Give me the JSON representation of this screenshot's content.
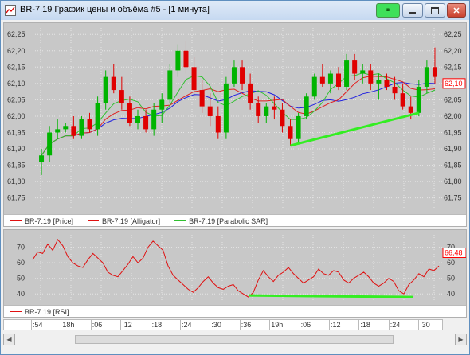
{
  "window": {
    "title": "BR-7.19 График цены и объёма #5 - [1 минута]",
    "buttons": [
      {
        "name": "link-button",
        "icon": "link-icon"
      },
      {
        "name": "minimize-button",
        "icon": "minimize-icon"
      },
      {
        "name": "maximize-button",
        "icon": "maximize-icon"
      },
      {
        "name": "close-button",
        "icon": "close-icon"
      }
    ]
  },
  "colors": {
    "price_up": "#00b400",
    "price_down": "#e00000",
    "alligator_jaw": "#2020e0",
    "alligator_teeth": "#e02020",
    "alligator_lips": "#30c030",
    "trendline": "#33ee22",
    "rsi_line": "#e01010",
    "current_price_box": "#ff0000",
    "pane_bg": "#c8c8c8",
    "grid": "#e6e6e6"
  },
  "price_pane": {
    "axis_labels": [
      "62,25",
      "62,20",
      "62,15",
      "62,10",
      "62,05",
      "62,00",
      "61,95",
      "61,90",
      "61,85",
      "61,80",
      "61,75"
    ],
    "current_price": "62,10",
    "legend": [
      {
        "label": "BR-7.19 [Price]",
        "color": "#e01010"
      },
      {
        "label": "BR-7.19 [Alligator]",
        "color": "#e01010"
      },
      {
        "label": "BR-7.19 [Parabolic SAR]",
        "color": "#30c030"
      }
    ]
  },
  "rsi_pane": {
    "axis_labels_left": [
      "70",
      "60",
      "50",
      "40"
    ],
    "axis_labels_right": [
      "70",
      "60",
      "50",
      "40"
    ],
    "current_value": "66,48",
    "legend": [
      {
        "label": "BR-7.19 [RSI]",
        "color": "#e01010"
      }
    ]
  },
  "time_axis": [
    ":54",
    "18h",
    ":06",
    ":12",
    ":18",
    ":24",
    ":30",
    ":36",
    "19h",
    ":06",
    ":12",
    ":18",
    ":24",
    ":30"
  ],
  "chart_data": {
    "type": "candlestick",
    "ylim": [
      61.72,
      62.27
    ],
    "candles": [
      {
        "o": 61.86,
        "h": 61.9,
        "l": 61.82,
        "c": 61.88
      },
      {
        "o": 61.88,
        "h": 61.97,
        "l": 61.86,
        "c": 61.95
      },
      {
        "o": 61.95,
        "h": 61.99,
        "l": 61.93,
        "c": 61.96
      },
      {
        "o": 61.96,
        "h": 61.98,
        "l": 61.95,
        "c": 61.97
      },
      {
        "o": 61.97,
        "h": 62.0,
        "l": 61.93,
        "c": 61.94
      },
      {
        "o": 61.94,
        "h": 62.0,
        "l": 61.93,
        "c": 61.99
      },
      {
        "o": 61.99,
        "h": 62.01,
        "l": 61.95,
        "c": 61.96
      },
      {
        "o": 61.96,
        "h": 62.06,
        "l": 61.94,
        "c": 62.04
      },
      {
        "o": 62.04,
        "h": 62.14,
        "l": 62.02,
        "c": 62.12
      },
      {
        "o": 62.12,
        "h": 62.16,
        "l": 62.07,
        "c": 62.08
      },
      {
        "o": 62.08,
        "h": 62.12,
        "l": 62.02,
        "c": 62.04
      },
      {
        "o": 62.04,
        "h": 62.06,
        "l": 61.97,
        "c": 61.98
      },
      {
        "o": 61.98,
        "h": 62.02,
        "l": 61.96,
        "c": 62.0
      },
      {
        "o": 62.0,
        "h": 62.02,
        "l": 61.95,
        "c": 61.96
      },
      {
        "o": 61.96,
        "h": 62.04,
        "l": 61.94,
        "c": 62.02
      },
      {
        "o": 62.02,
        "h": 62.07,
        "l": 61.98,
        "c": 62.05
      },
      {
        "o": 62.05,
        "h": 62.16,
        "l": 62.04,
        "c": 62.14
      },
      {
        "o": 62.14,
        "h": 62.22,
        "l": 62.12,
        "c": 62.2
      },
      {
        "o": 62.2,
        "h": 62.23,
        "l": 62.13,
        "c": 62.15
      },
      {
        "o": 62.15,
        "h": 62.18,
        "l": 62.06,
        "c": 62.08
      },
      {
        "o": 62.08,
        "h": 62.11,
        "l": 62.01,
        "c": 62.03
      },
      {
        "o": 62.03,
        "h": 62.07,
        "l": 61.97,
        "c": 62.0
      },
      {
        "o": 62.0,
        "h": 62.03,
        "l": 61.93,
        "c": 61.95
      },
      {
        "o": 61.95,
        "h": 62.12,
        "l": 61.93,
        "c": 62.1
      },
      {
        "o": 62.1,
        "h": 62.17,
        "l": 62.09,
        "c": 62.15
      },
      {
        "o": 62.15,
        "h": 62.17,
        "l": 62.08,
        "c": 62.1
      },
      {
        "o": 62.1,
        "h": 62.13,
        "l": 62.02,
        "c": 62.04
      },
      {
        "o": 62.04,
        "h": 62.06,
        "l": 61.98,
        "c": 62.0
      },
      {
        "o": 62.0,
        "h": 62.04,
        "l": 61.98,
        "c": 62.03
      },
      {
        "o": 62.03,
        "h": 62.06,
        "l": 61.99,
        "c": 62.02
      },
      {
        "o": 62.02,
        "h": 62.04,
        "l": 61.95,
        "c": 61.97
      },
      {
        "o": 61.97,
        "h": 61.99,
        "l": 61.91,
        "c": 61.93
      },
      {
        "o": 61.93,
        "h": 62.01,
        "l": 61.92,
        "c": 62.0
      },
      {
        "o": 62.0,
        "h": 62.07,
        "l": 61.99,
        "c": 62.06
      },
      {
        "o": 62.06,
        "h": 62.13,
        "l": 62.05,
        "c": 62.12
      },
      {
        "o": 62.12,
        "h": 62.16,
        "l": 62.09,
        "c": 62.1
      },
      {
        "o": 62.1,
        "h": 62.14,
        "l": 62.07,
        "c": 62.13
      },
      {
        "o": 62.13,
        "h": 62.15,
        "l": 62.08,
        "c": 62.09
      },
      {
        "o": 62.09,
        "h": 62.19,
        "l": 62.08,
        "c": 62.17
      },
      {
        "o": 62.17,
        "h": 62.19,
        "l": 62.11,
        "c": 62.13
      },
      {
        "o": 62.13,
        "h": 62.16,
        "l": 62.1,
        "c": 62.14
      },
      {
        "o": 62.14,
        "h": 62.16,
        "l": 62.08,
        "c": 62.1
      },
      {
        "o": 62.1,
        "h": 62.13,
        "l": 62.05,
        "c": 62.11
      },
      {
        "o": 62.11,
        "h": 62.13,
        "l": 62.08,
        "c": 62.09
      },
      {
        "o": 62.09,
        "h": 62.12,
        "l": 62.05,
        "c": 62.07
      },
      {
        "o": 62.07,
        "h": 62.1,
        "l": 62.02,
        "c": 62.03
      },
      {
        "o": 62.03,
        "h": 62.06,
        "l": 61.99,
        "c": 62.01
      },
      {
        "o": 62.01,
        "h": 62.11,
        "l": 62.0,
        "c": 62.09
      },
      {
        "o": 62.09,
        "h": 62.17,
        "l": 62.07,
        "c": 62.15
      },
      {
        "o": 62.15,
        "h": 62.21,
        "l": 62.1,
        "c": 62.12
      }
    ],
    "trendline_points": [
      [
        31,
        61.91
      ],
      [
        47,
        62.01
      ]
    ],
    "rsi": {
      "ylim": [
        35,
        78
      ],
      "values": [
        62,
        67,
        66,
        72,
        68,
        75,
        71,
        64,
        60,
        58,
        57,
        62,
        66,
        63,
        60,
        54,
        52,
        51,
        55,
        59,
        64,
        60,
        63,
        70,
        74,
        71,
        68,
        58,
        52,
        49,
        46,
        43,
        41,
        44,
        48,
        51,
        47,
        44,
        43,
        45,
        46,
        42,
        40,
        38,
        41,
        49,
        55,
        51,
        48,
        52,
        54,
        57,
        53,
        50,
        47,
        49,
        51,
        56,
        53,
        52,
        55,
        54,
        49,
        47,
        50,
        52,
        54,
        51,
        47,
        45,
        47,
        50,
        48,
        42,
        40,
        46,
        49,
        53,
        51,
        56,
        55,
        58
      ],
      "trendline_points": [
        [
          0.528,
          39
        ],
        [
          0.93,
          38
        ]
      ]
    }
  }
}
